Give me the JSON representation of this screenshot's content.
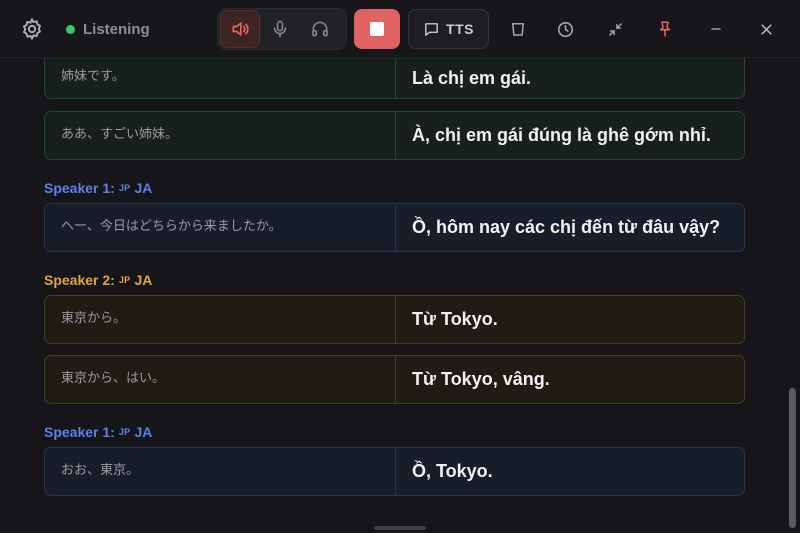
{
  "toolbar": {
    "status_label": "Listening",
    "tts_label": "TTS"
  },
  "colors": {
    "accent_red": "#e06363",
    "status_green": "#37c86a",
    "speaker1": "#5b82e8",
    "speaker2": "#e2a338"
  },
  "icons": {
    "settings": "gear-icon",
    "speaker": "speaker-icon",
    "mic": "mic-icon",
    "headphones": "headphones-icon",
    "stop": "stop-icon",
    "tts": "message-icon",
    "clear": "trash-icon",
    "history": "clock-icon",
    "compact": "minimize-arrows-icon",
    "pin": "pin-icon",
    "window_min": "minus-icon",
    "window_close": "close-icon"
  },
  "transcript": {
    "speakers": [
      {
        "label": "Speaker 1:",
        "flag": "JP",
        "lang": "JA"
      },
      {
        "label": "Speaker 2:",
        "flag": "JP",
        "lang": "JA"
      },
      {
        "label": "Speaker 1:",
        "flag": "JP",
        "lang": "JA"
      }
    ],
    "entries": [
      {
        "source": "姉妹です。",
        "translation": "Là chị em gái."
      },
      {
        "source": "ああ、すごい姉妹。",
        "translation": "À, chị em gái đúng là ghê gớm nhỉ."
      },
      {
        "source": "へー、今日はどちらから来ましたか。",
        "translation": "Ồ, hôm nay các chị đến từ đâu vậy?"
      },
      {
        "source": "東京から。",
        "translation": "Từ Tokyo."
      },
      {
        "source": "東京から、はい。",
        "translation": "Từ Tokyo, vâng."
      },
      {
        "source": "おお、東京。",
        "translation": "Ồ, Tokyo."
      }
    ]
  }
}
